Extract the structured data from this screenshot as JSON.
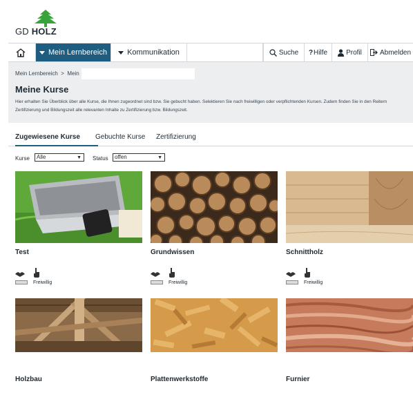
{
  "header": {
    "logo_prefix": "GD",
    "logo_bold": "HOLZ"
  },
  "nav": {
    "home_icon": "home-icon",
    "lernbereich": "Mein Lernbereich",
    "kommunikation": "Kommunikation",
    "suche": "Suche",
    "hilfe": "Hilfe",
    "profil": "Profil",
    "abmelden": "Abmelden"
  },
  "breadcrumb": {
    "root": "Mein Lernbereich",
    "sep": ">",
    "current": "Mein"
  },
  "page": {
    "title": "Meine Kurse",
    "description": "Hier erhalten Sie Überblick über alle Kurse, die Ihnen zugeordnet sind bzw. Sie gebucht haben. Selektieren Sie nach freiwilligen oder verpflichtenden Kursen. Zudem finden Sie in den Reitern Zertifizierung und Bildungszeit alle relevanten Inhalte zu Zertifizierung bzw. Bildungszeit."
  },
  "tabs": [
    {
      "label": "Zugewiesene Kurse",
      "active": true
    },
    {
      "label": "Gebuchte Kurse",
      "active": false
    },
    {
      "label": "Zertifizierung",
      "active": false
    }
  ],
  "filters": {
    "kurse_label": "Kurse",
    "kurse_value": "Alle",
    "status_label": "Status",
    "status_value": "offen"
  },
  "courses": [
    {
      "name": "Test",
      "tag": "Freiwillig",
      "show_meta": true
    },
    {
      "name": "Grundwissen",
      "tag": "Freiwillig",
      "show_meta": true
    },
    {
      "name": "Schnittholz",
      "tag": "Freiwillig",
      "show_meta": true
    },
    {
      "name": "Holzbau",
      "tag": "",
      "show_meta": false
    },
    {
      "name": "Plattenwerkstoffe",
      "tag": "",
      "show_meta": false
    },
    {
      "name": "Furnier",
      "tag": "",
      "show_meta": false
    }
  ],
  "colors": {
    "accent": "#1e5c80",
    "panel": "#eceef0",
    "logo_green": "#3aa23a"
  }
}
